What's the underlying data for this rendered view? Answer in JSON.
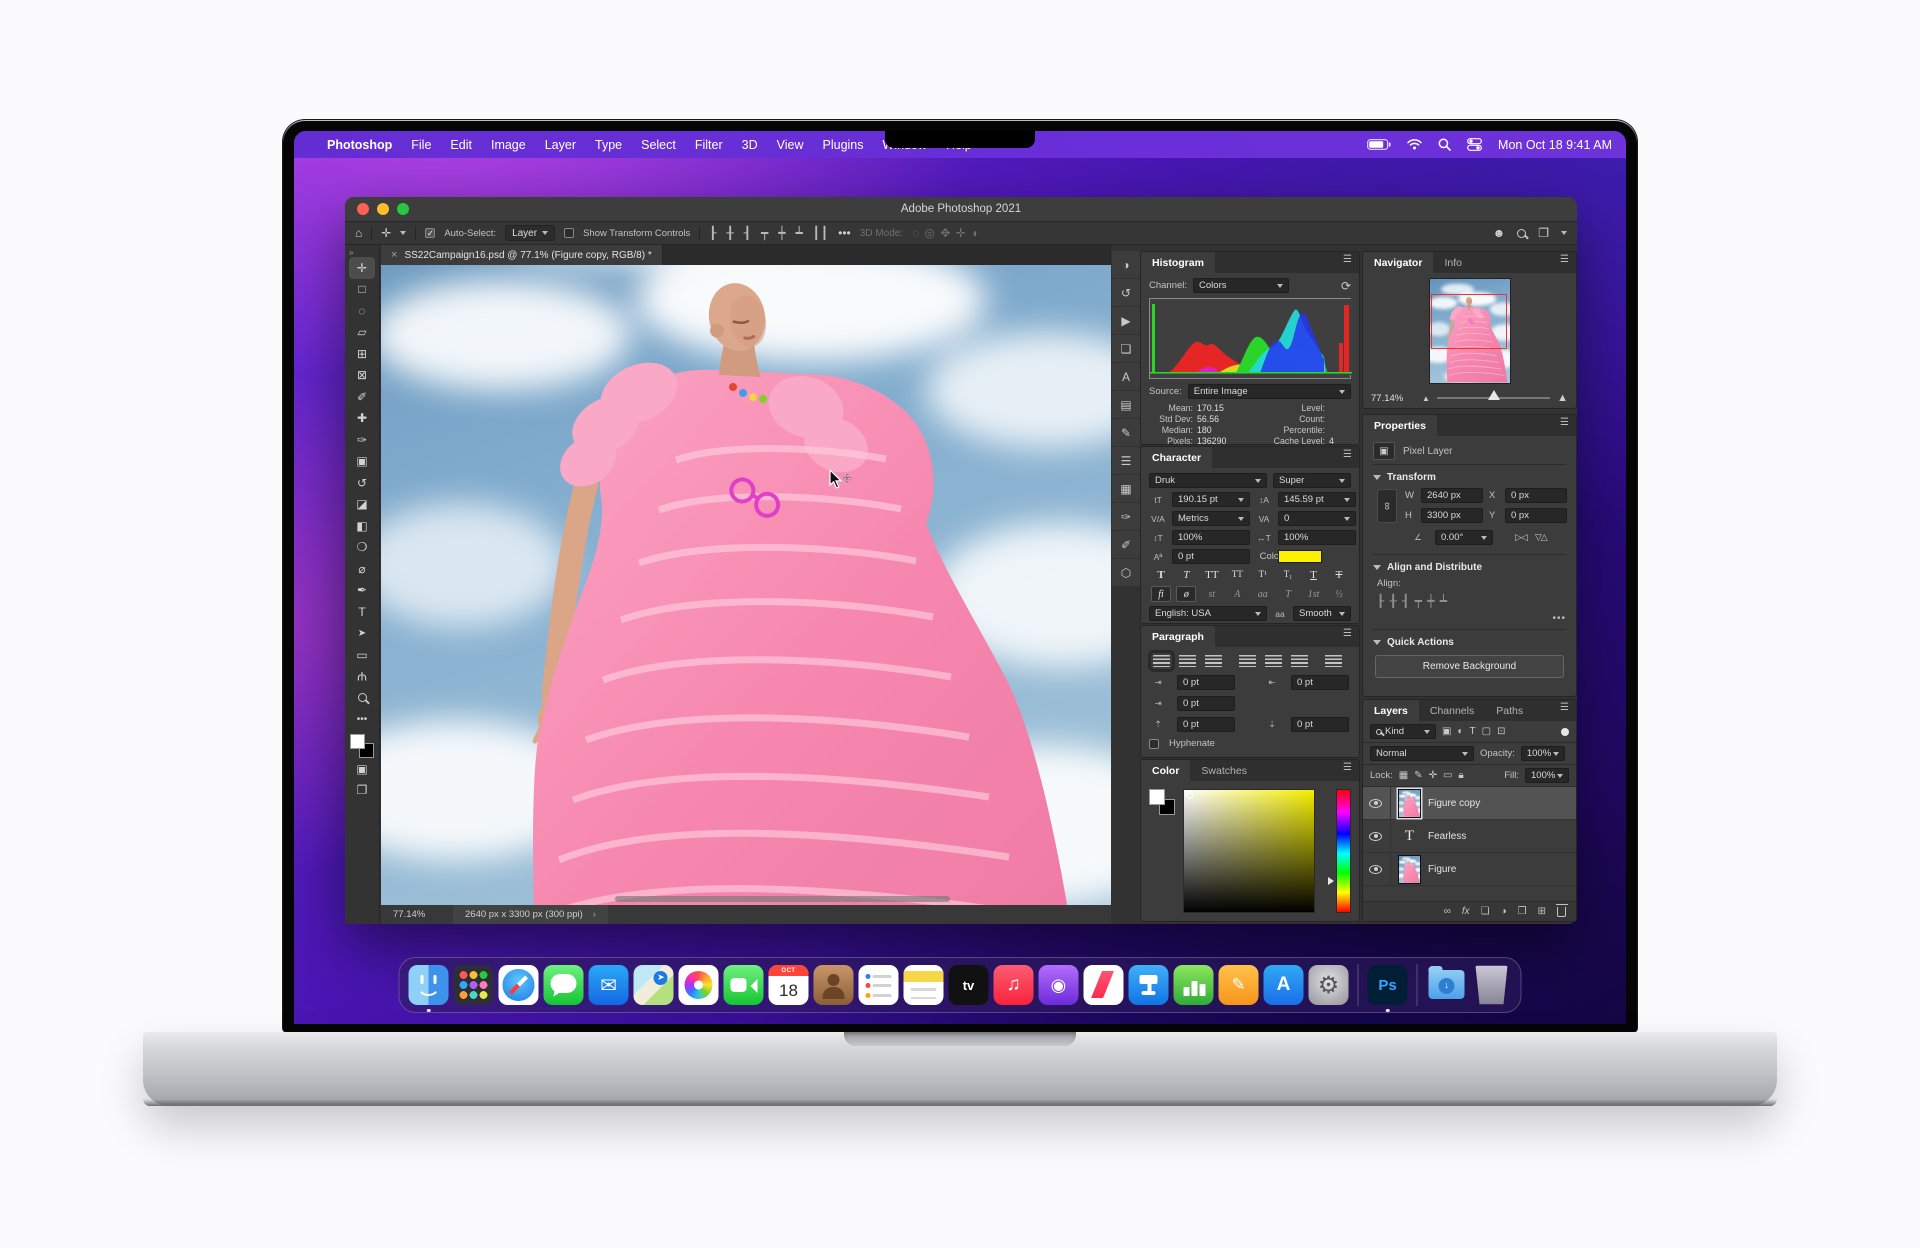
{
  "menu_bar": {
    "apple_glyph": "",
    "items": [
      "Photoshop",
      "File",
      "Edit",
      "Image",
      "Layer",
      "Type",
      "Select",
      "Filter",
      "3D",
      "View",
      "Plugins",
      "Window",
      "Help"
    ],
    "clock": "Mon Oct 18  9:41 AM"
  },
  "window": {
    "title": "Adobe Photoshop 2021"
  },
  "options_bar": {
    "home_glyph": "⌂",
    "tool_glyph": "✛",
    "auto_select_label": "Auto-Select:",
    "auto_select_value": "Layer",
    "check_glyph": "✓",
    "show_transform_label": "Show Transform Controls",
    "more_glyph": "•••",
    "mode_3d_label": "3D Mode:",
    "share_glyph": "☻"
  },
  "document_tab": {
    "close_glyph": "×",
    "title": "SS22Campaign16.psd @ 77.1% (Figure copy, RGB/8) *"
  },
  "tools": [
    {
      "name": "move-tool",
      "glyph": "✛"
    },
    {
      "name": "marquee-tool",
      "glyph": "□"
    },
    {
      "name": "lasso-tool",
      "glyph": "◌"
    },
    {
      "name": "object-selection-tool",
      "glyph": "▱"
    },
    {
      "name": "crop-tool",
      "glyph": "⊞"
    },
    {
      "name": "frame-tool",
      "glyph": "⊠"
    },
    {
      "name": "eyedropper-tool",
      "glyph": "✐"
    },
    {
      "name": "healing-brush-tool",
      "glyph": "✚"
    },
    {
      "name": "brush-tool",
      "glyph": "✑"
    },
    {
      "name": "clone-stamp-tool",
      "glyph": "▣"
    },
    {
      "name": "history-brush-tool",
      "glyph": "↺"
    },
    {
      "name": "eraser-tool",
      "glyph": "◪"
    },
    {
      "name": "gradient-tool",
      "glyph": "◧"
    },
    {
      "name": "blur-tool",
      "glyph": "❍"
    },
    {
      "name": "dodge-tool",
      "glyph": "⌀"
    },
    {
      "name": "pen-tool",
      "glyph": "✒"
    },
    {
      "name": "type-tool",
      "glyph": "T"
    },
    {
      "name": "path-selection-tool",
      "glyph": "➤"
    },
    {
      "name": "rectangle-tool",
      "glyph": "▭"
    },
    {
      "name": "hand-tool",
      "glyph": "Ψ"
    },
    {
      "name": "zoom-tool",
      "glyph": ""
    },
    {
      "name": "edit-toolbar",
      "glyph": "•••"
    },
    {
      "name": "quick-mask-mode",
      "glyph": "▣"
    },
    {
      "name": "screen-mode",
      "glyph": "❐"
    }
  ],
  "icon_column": [
    "adjustments",
    "history",
    "actions",
    "libraries",
    "glyphs",
    "character-styles",
    "paragraph-styles",
    "timeline",
    "patterns",
    "brush-settings",
    "brushes",
    "3d"
  ],
  "icon_column_glyphs": [
    "◑",
    "↺",
    "▶",
    "❏",
    "A",
    "▤",
    "✎",
    "☰",
    "▦",
    "✑",
    "✐",
    "⬡"
  ],
  "histogram": {
    "title": "Histogram",
    "channel_label": "Channel:",
    "channel_value": "Colors",
    "source_label": "Source:",
    "source_value": "Entire Image",
    "mean_label": "Mean:",
    "mean": "170.15",
    "std_label": "Std Dev:",
    "std": "56.56",
    "median_label": "Median:",
    "median": "180",
    "pixels_label": "Pixels:",
    "pixels": "136290",
    "level_label": "Level:",
    "count_label": "Count:",
    "percentile_label": "Percentile:",
    "cache_label": "Cache Level:",
    "cache": "4"
  },
  "character": {
    "title": "Character",
    "font": "Druk",
    "style": "Super",
    "size_icon": "tT",
    "size": "190.15 pt",
    "leading_icon": "↕A",
    "leading": "145.59 pt",
    "kerning_icon": "V/A",
    "kerning": "Metrics",
    "tracking_icon": "VA",
    "tracking": "0",
    "v_scale_icon": "↕T",
    "v_scale": "100%",
    "h_scale_icon": "↔T",
    "h_scale": "100%",
    "baseline_icon": "Aª",
    "baseline": "0 pt",
    "color_label": "Color:",
    "color_value": "#fdf000",
    "styles": [
      "T",
      "T",
      "TT",
      "TT",
      "T¹",
      "T₁",
      "T",
      "T"
    ],
    "opentype": [
      "fi",
      "ø",
      "st",
      "A",
      "aa",
      "T",
      "1st",
      "½"
    ],
    "language": "English: USA",
    "aa_icon": "aa",
    "smoothing": "Smooth"
  },
  "paragraph": {
    "title": "Paragraph",
    "indent_left_icon": "⇥",
    "indent_left": "0 pt",
    "indent_right_icon": "⇤",
    "indent_right": "0 pt",
    "indent_first_icon": "⇥",
    "indent_first": "0 pt",
    "space_before_icon": "⇡",
    "space_before": "0 pt",
    "space_after_icon": "⇣",
    "space_after": "0 pt",
    "hyphenate_label": "Hyphenate"
  },
  "color_panel": {
    "tabs": [
      "Color",
      "Swatches"
    ]
  },
  "navigator": {
    "tabs": [
      "Navigator",
      "Info"
    ],
    "zoom": "77.14%",
    "zoom_out_glyph": "▲",
    "zoom_in_glyph": "▲"
  },
  "properties": {
    "title": "Properties",
    "layer_type": "Pixel Layer",
    "transform_label": "Transform",
    "link_glyph": "∞",
    "w_label": "W",
    "w": "2640 px",
    "x_label": "X",
    "x": "0 px",
    "h_label": "H",
    "h": "3300 px",
    "y_label": "Y",
    "y": "0 px",
    "angle_icon": "∠",
    "angle": "0.00°",
    "flip_h_glyph": "▷◁",
    "flip_v_glyph": "▽△",
    "align_label": "Align and Distribute",
    "align_sub": "Align:",
    "align_glyphs": "┠ ╂ ┨  ┯ ┿ ┷",
    "more_glyph": "•••",
    "qa_label": "Quick Actions",
    "remove_bg_label": "Remove Background"
  },
  "layers": {
    "tabs": [
      "Layers",
      "Channels",
      "Paths"
    ],
    "kind": "Kind",
    "filter_glyphs": [
      "▣",
      "◐",
      "T",
      "▢",
      "⊡"
    ],
    "blend": "Normal",
    "opacity_label": "Opacity:",
    "opacity": "100%",
    "lock_label": "Lock:",
    "lock_glyphs": [
      "▦",
      "✎",
      "✛",
      "▭"
    ],
    "fill_label": "Fill:",
    "fill": "100%",
    "rows": [
      {
        "name": "Figure copy",
        "type": "image"
      },
      {
        "name": "Fearless",
        "type": "text"
      },
      {
        "name": "Figure",
        "type": "image"
      }
    ],
    "text_thumb_glyph": "T",
    "foot_glyphs": {
      "link": "∞",
      "fx": "fx",
      "mask": "❏",
      "adjust": "◑",
      "group": "❒",
      "new": "⊞"
    }
  },
  "status_bar": {
    "zoom": "77.14%",
    "doc_info": "2640 px x 3300 px (300 ppi)",
    "chevron": "›"
  },
  "dock": {
    "items": [
      "finder",
      "launchpad",
      "safari",
      "messages",
      "mail",
      "maps",
      "photos",
      "facetime",
      "calendar",
      "contacts",
      "reminders",
      "notes",
      "tv",
      "music",
      "podcasts",
      "news",
      "keynote",
      "numbers",
      "pages",
      "app-store",
      "system-preferences",
      "photoshop",
      "downloads",
      "trash"
    ],
    "calendar_month": "OCT",
    "calendar_day": "18",
    "tv_label": "tv",
    "mail_glyph": "✉",
    "music_glyph": "♫",
    "podcasts_glyph": "◉",
    "pages_glyph": "✎",
    "appstore_glyph": "A",
    "settings_glyph": "⚙",
    "maps_glyph": "➤",
    "downloads_glyph": "↓",
    "ps_label": "Ps"
  },
  "colors": {
    "menubar_purple": "#6232d4",
    "ps_panel_gray": "#3c3c3c",
    "ps_blue": "#31a8ff",
    "char_color_swatch": "#fdf000",
    "selection_red": "#ee3333"
  }
}
